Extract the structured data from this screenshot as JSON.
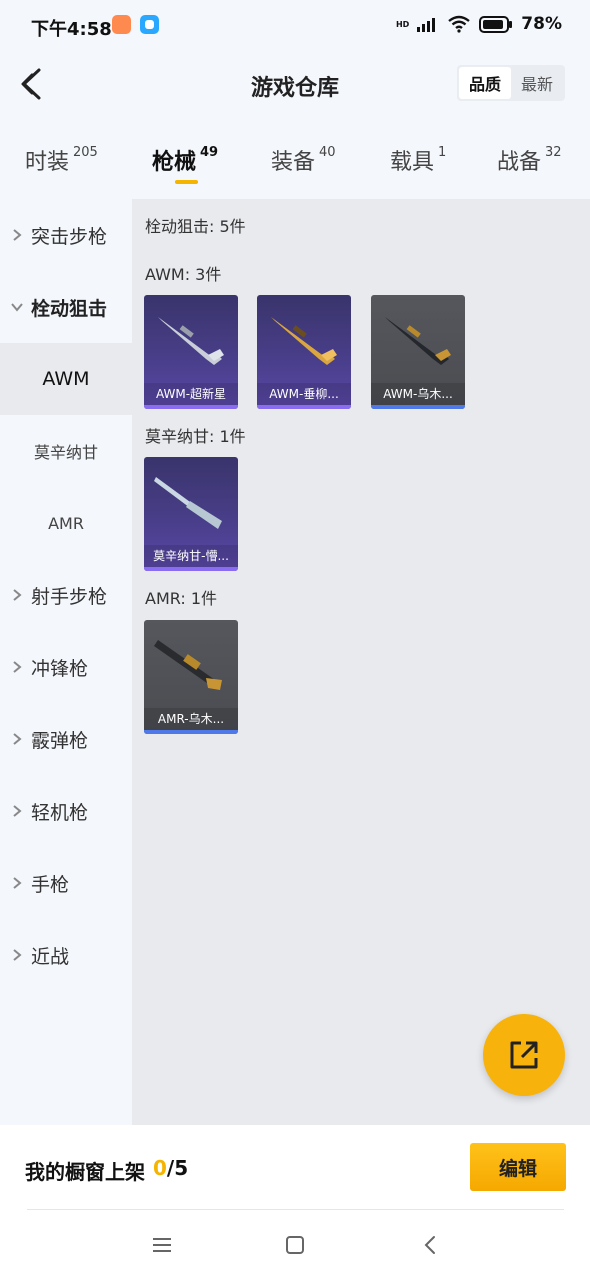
{
  "status_bar": {
    "time": "下午4:58",
    "hd": "HD",
    "battery": "78%"
  },
  "header": {
    "title": "游戏仓库",
    "sort_options": [
      "品质",
      "最新"
    ],
    "active_sort": "品质"
  },
  "tabs": [
    {
      "label": "时装",
      "count": "205"
    },
    {
      "label": "枪械",
      "count": "49"
    },
    {
      "label": "装备",
      "count": "40"
    },
    {
      "label": "载具",
      "count": "1"
    },
    {
      "label": "战备",
      "count": "32"
    }
  ],
  "active_tab": "枪械",
  "sidebar": {
    "items": [
      {
        "label": "突击步枪"
      },
      {
        "label": "栓动狙击"
      },
      {
        "label": "射手步枪"
      },
      {
        "label": "冲锋枪"
      },
      {
        "label": "霰弹枪"
      },
      {
        "label": "轻机枪"
      },
      {
        "label": "手枪"
      },
      {
        "label": "近战"
      }
    ],
    "subitems": [
      "AWM",
      "莫辛纳甘",
      "AMR"
    ],
    "selected_sub": "AWM"
  },
  "content": {
    "category_header": "栓动狙击: 5件",
    "sections": [
      {
        "header": "AWM: 3件",
        "cards": [
          {
            "name": "AWM-超新星",
            "bg": "purple"
          },
          {
            "name": "AWM-垂柳...",
            "bg": "purple"
          },
          {
            "name": "AWM-乌木...",
            "bg": "gray"
          }
        ]
      },
      {
        "header": "莫辛纳甘: 1件",
        "cards": [
          {
            "name": "莫辛纳甘-懵...",
            "bg": "purple"
          }
        ]
      },
      {
        "header": "AMR: 1件",
        "cards": [
          {
            "name": "AMR-乌木...",
            "bg": "gray"
          }
        ]
      }
    ]
  },
  "bottom": {
    "shelf_label": "我的橱窗上架",
    "shelf_current": "0",
    "shelf_max": "/5",
    "edit_label": "编辑"
  },
  "colors": {
    "accent": "#f5b400",
    "content_bg": "#e8eaee",
    "purple_card": "#4a3f8c",
    "gray_card": "#4a4c51"
  }
}
